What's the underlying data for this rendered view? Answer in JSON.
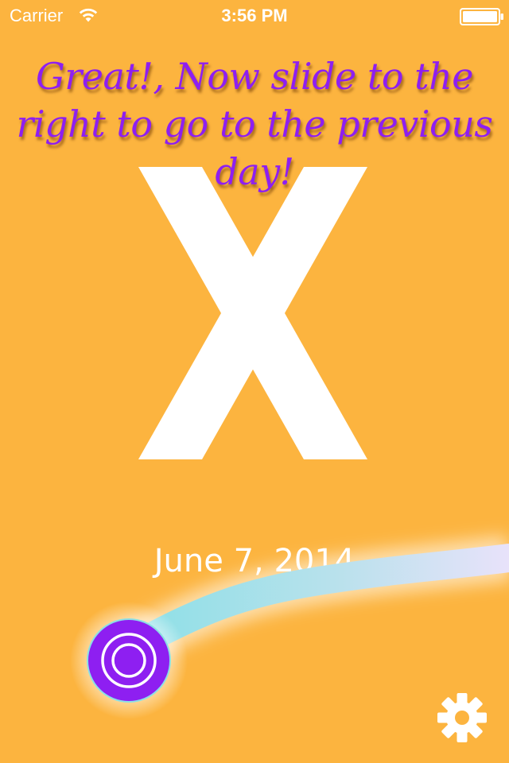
{
  "status_bar": {
    "carrier": "Carrier",
    "time": "3:56 PM",
    "icons": [
      "wifi-icon",
      "battery-icon"
    ]
  },
  "instruction": {
    "lines": [
      "Great!, Now slide to the",
      "right to go to the previous",
      "day!"
    ],
    "color": "#8E1FF1"
  },
  "big_mark": {
    "glyph": "X",
    "color": "#ffffff"
  },
  "date": {
    "label": "June 7, 2014"
  },
  "slider": {
    "handle_color": "#8E1FF1",
    "track_gradient": [
      "#8BE0E6",
      "#B9E1EC",
      "#E8E2FA"
    ]
  },
  "settings": {
    "icon": "gear-icon"
  },
  "colors": {
    "background": "#FCB43F"
  }
}
